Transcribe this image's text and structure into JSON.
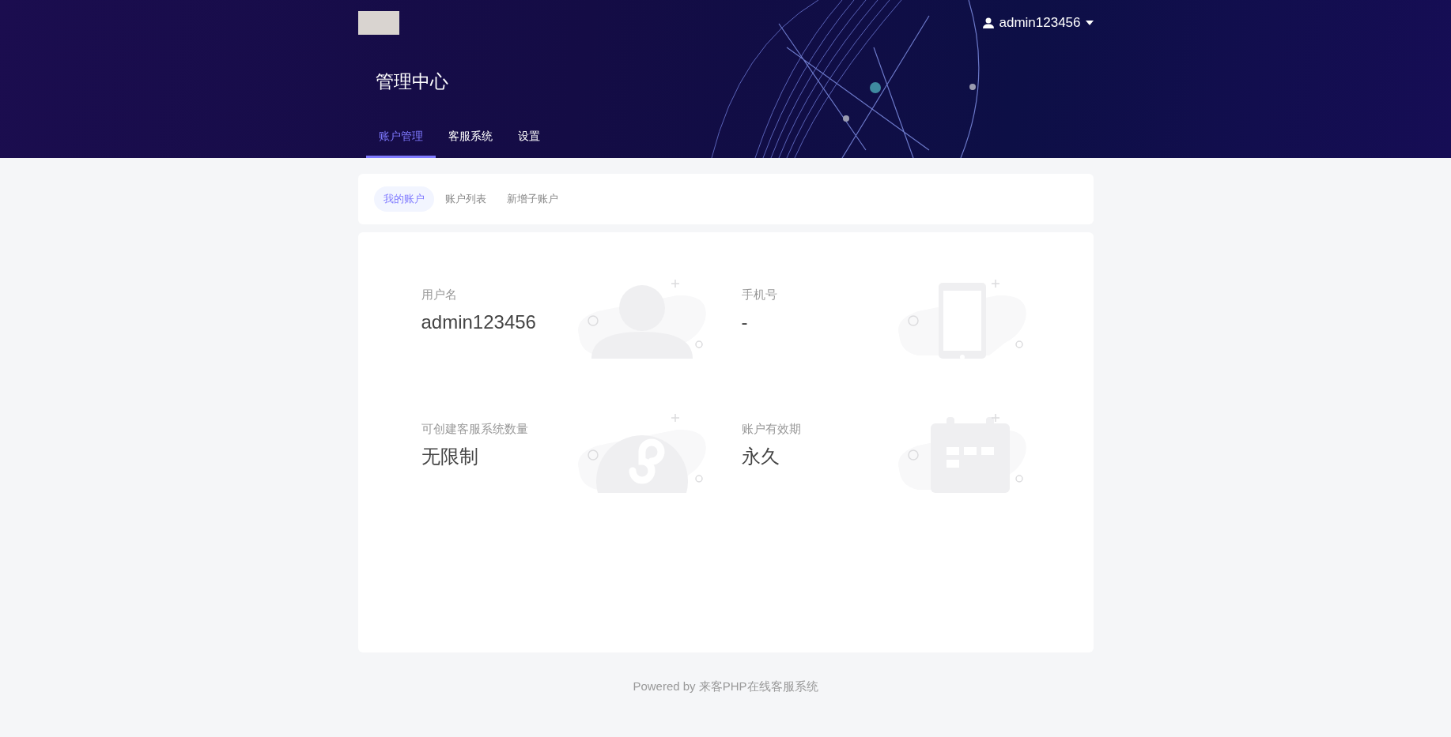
{
  "header": {
    "user": "admin123456",
    "title": "管理中心"
  },
  "tabs": [
    {
      "label": "账户管理",
      "selected": true
    },
    {
      "label": "客服系统",
      "selected": false
    },
    {
      "label": "设置",
      "selected": false
    }
  ],
  "subtabs": [
    {
      "label": "我的账户",
      "selected": true
    },
    {
      "label": "账户列表",
      "selected": false
    },
    {
      "label": "新增子账户",
      "selected": false
    }
  ],
  "info": [
    {
      "label": "用户名",
      "value": "admin123456",
      "kind": "person"
    },
    {
      "label": "手机号",
      "value": "-",
      "kind": "phone"
    },
    {
      "label": "可创建客服系统数量",
      "value": "无限制",
      "kind": "link"
    },
    {
      "label": "账户有效期",
      "value": "永久",
      "kind": "calendar"
    }
  ],
  "footer": "Powered by 来客PHP在线客服系统"
}
